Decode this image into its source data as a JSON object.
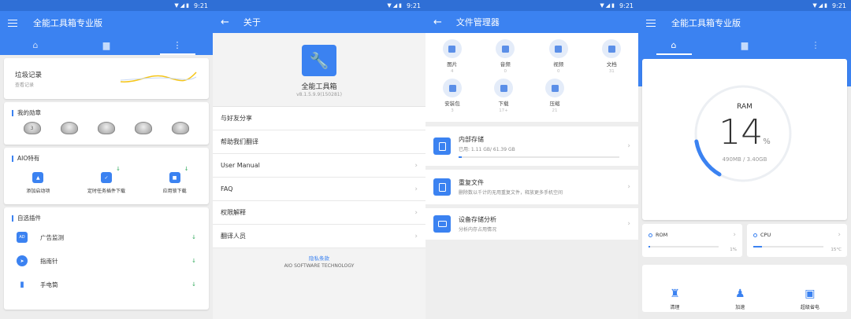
{
  "status_time": "9:21",
  "status_icons": "▼◢▮",
  "screen1": {
    "title": "全能工具箱专业版",
    "trash": {
      "title": "垃圾记录",
      "subtitle": "查看记录"
    },
    "medals": {
      "title": "我的勋章",
      "items": [
        "3",
        "",
        "",
        "",
        ""
      ]
    },
    "aio": {
      "title": "AIO特有",
      "items": [
        {
          "label": "添加启动项",
          "icon": "launch-icon"
        },
        {
          "label": "定时任务插件下载",
          "icon": "calendar-icon"
        },
        {
          "label": "应用锁下载",
          "icon": "lock-icon"
        }
      ]
    },
    "plugins": {
      "title": "自选插件",
      "items": [
        {
          "label": "广告监测",
          "icon": "AD"
        },
        {
          "label": "指南针",
          "icon": "compass-icon"
        },
        {
          "label": "手电筒",
          "icon": "flashlight-icon"
        }
      ]
    }
  },
  "screen2": {
    "title": "关于",
    "app_name": "全能工具箱",
    "version": "v8.1.5.9.9(150281)",
    "rows": [
      "与好友分享",
      "帮助我们翻译",
      "User Manual",
      "FAQ",
      "权限解释",
      "翻译人员"
    ],
    "privacy": "隐私条款",
    "company": "AIO SOFTWARE TECHNOLOGY"
  },
  "screen3": {
    "title": "文件管理器",
    "categories": [
      {
        "label": "图片",
        "count": "4"
      },
      {
        "label": "音频",
        "count": "0"
      },
      {
        "label": "视频",
        "count": "0"
      },
      {
        "label": "文档",
        "count": "31"
      },
      {
        "label": "安装包",
        "count": "3"
      },
      {
        "label": "下载",
        "count": "17+"
      },
      {
        "label": "压缩",
        "count": "21"
      }
    ],
    "internal": {
      "title": "内部存储",
      "detail": "已用: 1.11 GB/ 61.39 GB",
      "used_fraction": 0.018
    },
    "duplicate": {
      "title": "重复文件",
      "detail": "删除数以千计的无用重复文件，释放更多手机空间"
    },
    "analysis": {
      "title": "设备存储分析",
      "detail": "分析内存占用情况"
    }
  },
  "screen4": {
    "title": "全能工具箱专业版",
    "ram": {
      "label": "RAM",
      "percent": "14",
      "unit": "%",
      "detail": "490MB / 3.40GB",
      "fraction": 0.14
    },
    "rom": {
      "label": "ROM",
      "value": "1%",
      "fraction": 0.01
    },
    "cpu": {
      "label": "CPU",
      "value": "15°C",
      "fraction": 0.12
    },
    "actions": [
      {
        "label": "清理",
        "icon": "broom-icon"
      },
      {
        "label": "加速",
        "icon": "rocket-icon"
      },
      {
        "label": "超级省电",
        "icon": "battery-icon"
      }
    ]
  },
  "colors": {
    "primary": "#3b82f1",
    "statusbar": "#2f6fd6",
    "accent_yellow": "#f5c518",
    "download_green": "#2ea85a"
  }
}
